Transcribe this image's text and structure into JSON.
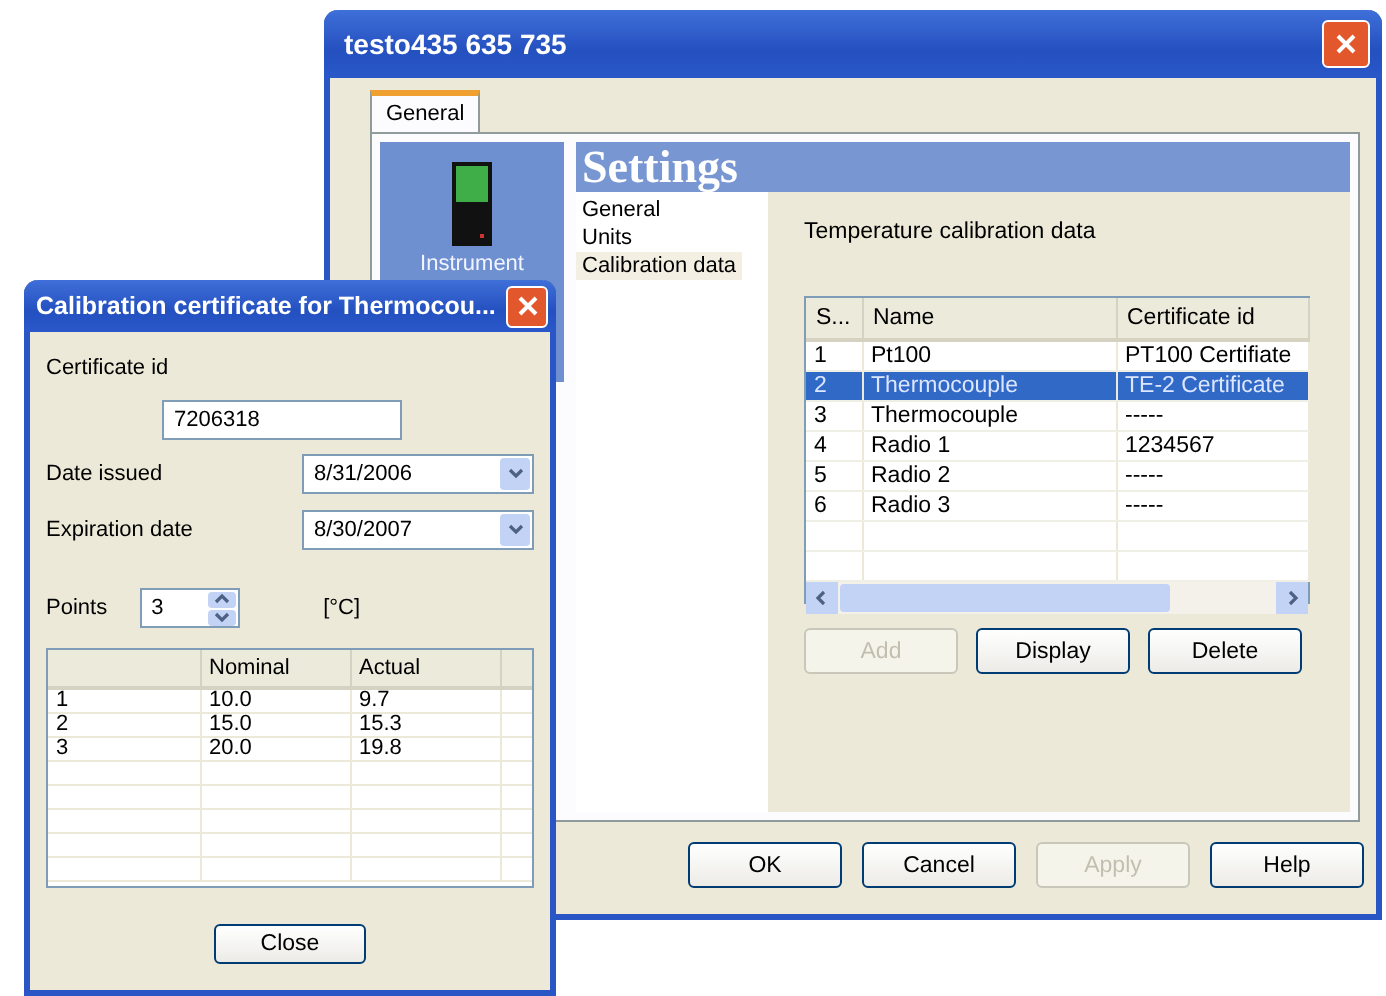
{
  "main_window": {
    "title": "testo435 635 735",
    "tabs": [
      {
        "label": "General",
        "selected": true
      }
    ],
    "instrument_tile": {
      "label": "Instrument"
    },
    "settings_header": "Settings",
    "nav_items": [
      {
        "label": "General",
        "selected": false
      },
      {
        "label": "Units",
        "selected": false
      },
      {
        "label": "Calibration data",
        "selected": true
      }
    ],
    "section_title": "Temperature calibration data",
    "table": {
      "columns": [
        "S...",
        "Name",
        "Certificate id"
      ],
      "rows": [
        {
          "cells": [
            "1",
            "Pt100",
            "PT100 Certifiate"
          ],
          "selected": false
        },
        {
          "cells": [
            "2",
            "Thermocouple",
            "TE-2 Certificate"
          ],
          "selected": true
        },
        {
          "cells": [
            "3",
            "Thermocouple",
            "-----"
          ],
          "selected": false
        },
        {
          "cells": [
            "4",
            "Radio 1",
            "1234567"
          ],
          "selected": false
        },
        {
          "cells": [
            "5",
            "Radio 2",
            "-----"
          ],
          "selected": false
        },
        {
          "cells": [
            "6",
            "Radio 3",
            "-----"
          ],
          "selected": false
        }
      ]
    },
    "table_buttons": [
      {
        "label": "Add",
        "disabled": true
      },
      {
        "label": "Display",
        "disabled": false
      },
      {
        "label": "Delete",
        "disabled": false
      }
    ],
    "footer_buttons": [
      {
        "label": "OK",
        "disabled": false
      },
      {
        "label": "Cancel",
        "disabled": false
      },
      {
        "label": "Apply",
        "disabled": true
      },
      {
        "label": "Help",
        "disabled": false
      }
    ]
  },
  "dialog": {
    "title": "Calibration certificate for Thermocou...",
    "certificate_id": {
      "label": "Certificate id",
      "value": "7206318"
    },
    "date_issued": {
      "label": "Date issued",
      "value": "8/31/2006"
    },
    "expiration_date": {
      "label": "Expiration date",
      "value": "8/30/2007"
    },
    "points": {
      "label": "Points",
      "value": "3"
    },
    "unit": "[°C]",
    "table": {
      "columns": [
        "",
        "Nominal",
        "Actual"
      ],
      "rows": [
        [
          "1",
          "10.0",
          "9.7"
        ],
        [
          "2",
          "15.0",
          "15.3"
        ],
        [
          "3",
          "20.0",
          "19.8"
        ]
      ]
    },
    "close_button": "Close"
  }
}
